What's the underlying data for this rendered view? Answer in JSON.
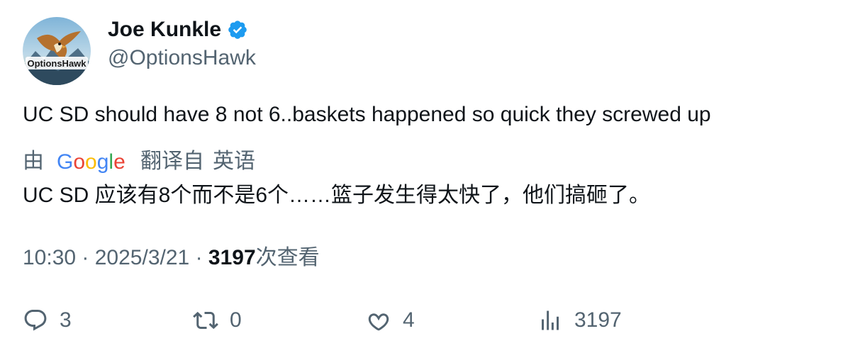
{
  "author": {
    "display_name": "Joe Kunkle",
    "handle": "@OptionsHawk",
    "verified": true,
    "avatar_logo_text": "OptionsHawk",
    "verified_color": "#1d9bf0"
  },
  "tweet": {
    "text": "UC SD should have 8 not 6..baskets happened so quick they screwed up",
    "translation": {
      "by_label": "由",
      "provider": "Google",
      "language_label": "翻译自",
      "source_language": "英语",
      "text": "UC SD 应该有8个而不是6个……篮子发生得太快了，他们搞砸了。"
    },
    "time": "10:30",
    "separator": "·",
    "date": "2025/3/21",
    "views_count": "3197",
    "views_label": "次查看"
  },
  "actions": {
    "reply_count": "3",
    "retweet_count": "0",
    "like_count": "4",
    "views_count": "3197"
  },
  "colors": {
    "text_primary": "#0f1419",
    "text_secondary": "#536471",
    "accent": "#1d9bf0"
  },
  "icons": {
    "reply": "reply-icon",
    "retweet": "retweet-icon",
    "like": "heart-icon",
    "views": "views-bar-chart-icon",
    "verified": "verified-badge-icon"
  }
}
